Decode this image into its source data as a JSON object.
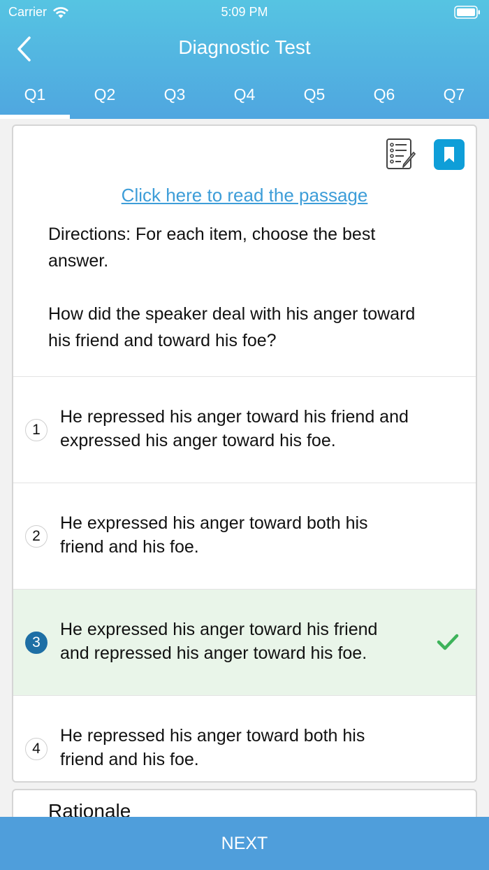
{
  "status": {
    "carrier": "Carrier",
    "time": "5:09 PM"
  },
  "header": {
    "title": "Diagnostic Test"
  },
  "tabs": [
    {
      "label": "Q1"
    },
    {
      "label": "Q2"
    },
    {
      "label": "Q3"
    },
    {
      "label": "Q4"
    },
    {
      "label": "Q5"
    },
    {
      "label": "Q6"
    },
    {
      "label": "Q7"
    }
  ],
  "question": {
    "passage_link": "Click here to read the passage",
    "directions": "Directions: For each item, choose the best answer.",
    "prompt": "How did the speaker deal with his anger toward his friend and toward his foe?",
    "options": [
      {
        "number": "1",
        "text": "He repressed his anger toward his friend and expressed his anger toward his foe."
      },
      {
        "number": "2",
        "text": "He expressed his anger toward both his friend and his foe."
      },
      {
        "number": "3",
        "text": "He expressed his anger toward his friend and repressed his anger toward his foe."
      },
      {
        "number": "4",
        "text": "He repressed his anger toward both his friend and his foe."
      }
    ]
  },
  "rationale": {
    "title": "Rationale"
  },
  "footer": {
    "next_label": "NEXT"
  },
  "colors": {
    "header_top": "#56c4e2",
    "header_bottom": "#4fa6e0",
    "link": "#3d9dd8",
    "selected_bg": "#e9f5e9",
    "check": "#3db35a",
    "bookmark": "#0f9ed8",
    "next_bar": "#4f9edb"
  }
}
